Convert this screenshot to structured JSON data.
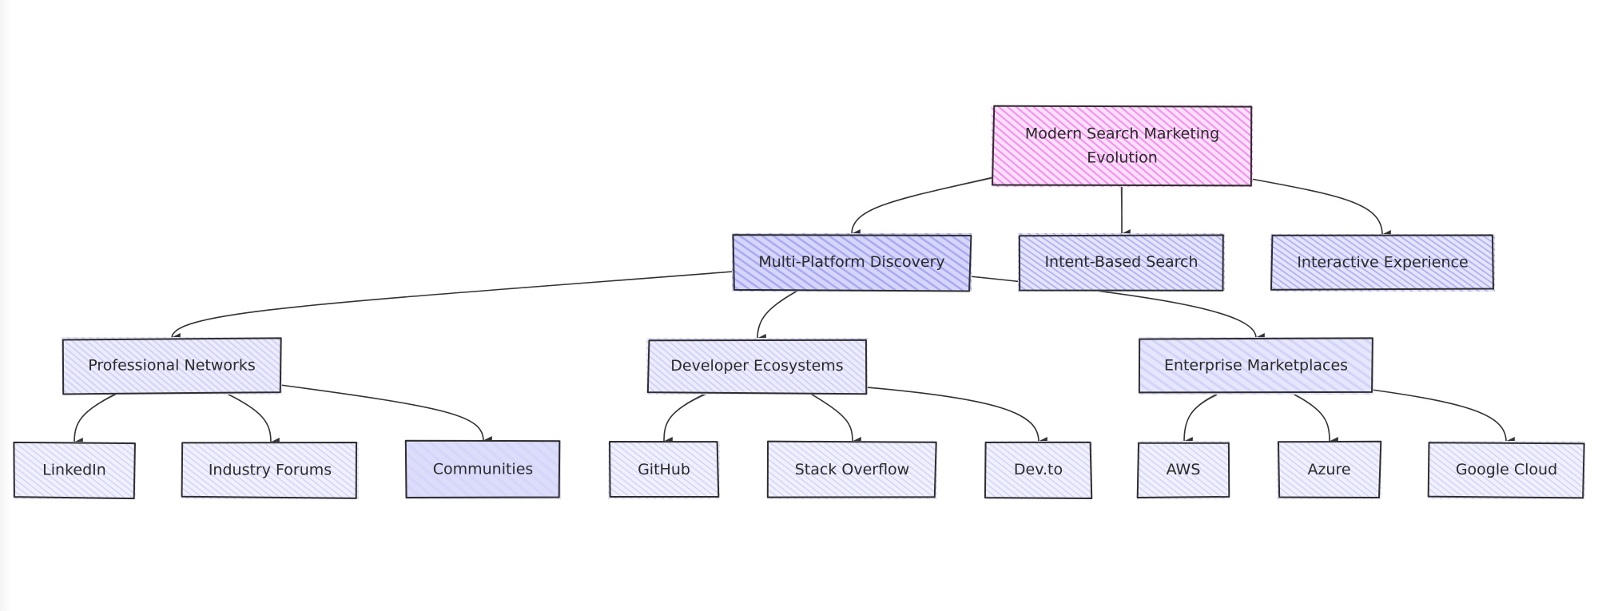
{
  "diagram": {
    "type": "flowchart-tree",
    "style": "hand-drawn",
    "colors": {
      "root_fill": "#f7a6f2",
      "level1_fill": "#b8b8f5",
      "level2_fill": "#d8d8fa",
      "leaf_fill": "#dcdcfb",
      "stroke": "#2e2e2e",
      "text": "#2b2b2b"
    },
    "nodes": [
      {
        "id": "root",
        "label_lines": [
          "Modern Search Marketing",
          "Evolution"
        ],
        "level": 0
      },
      {
        "id": "mpd",
        "label_lines": [
          "Multi-Platform Discovery"
        ],
        "level": 1
      },
      {
        "id": "ibs",
        "label_lines": [
          "Intent-Based Search"
        ],
        "level": 1
      },
      {
        "id": "ie",
        "label_lines": [
          "Interactive Experience"
        ],
        "level": 1
      },
      {
        "id": "pn",
        "label_lines": [
          "Professional Networks"
        ],
        "level": 2
      },
      {
        "id": "de",
        "label_lines": [
          "Developer Ecosystems"
        ],
        "level": 2
      },
      {
        "id": "em",
        "label_lines": [
          "Enterprise Marketplaces"
        ],
        "level": 2
      },
      {
        "id": "linkedin",
        "label_lines": [
          "LinkedIn"
        ],
        "level": 3
      },
      {
        "id": "forums",
        "label_lines": [
          "Industry Forums"
        ],
        "level": 3
      },
      {
        "id": "communities",
        "label_lines": [
          "Communities"
        ],
        "level": 3
      },
      {
        "id": "github",
        "label_lines": [
          "GitHub"
        ],
        "level": 3
      },
      {
        "id": "so",
        "label_lines": [
          "Stack Overflow"
        ],
        "level": 3
      },
      {
        "id": "devto",
        "label_lines": [
          "Dev.to"
        ],
        "level": 3
      },
      {
        "id": "aws",
        "label_lines": [
          "AWS"
        ],
        "level": 3
      },
      {
        "id": "azure",
        "label_lines": [
          "Azure"
        ],
        "level": 3
      },
      {
        "id": "gcloud",
        "label_lines": [
          "Google Cloud"
        ],
        "level": 3
      }
    ],
    "edges": [
      {
        "from": "root",
        "to": "mpd"
      },
      {
        "from": "root",
        "to": "ibs"
      },
      {
        "from": "root",
        "to": "ie"
      },
      {
        "from": "mpd",
        "to": "pn"
      },
      {
        "from": "mpd",
        "to": "de"
      },
      {
        "from": "mpd",
        "to": "em"
      },
      {
        "from": "pn",
        "to": "linkedin"
      },
      {
        "from": "pn",
        "to": "forums"
      },
      {
        "from": "pn",
        "to": "communities"
      },
      {
        "from": "de",
        "to": "github"
      },
      {
        "from": "de",
        "to": "so"
      },
      {
        "from": "de",
        "to": "devto"
      },
      {
        "from": "em",
        "to": "aws"
      },
      {
        "from": "em",
        "to": "azure"
      },
      {
        "from": "em",
        "to": "gcloud"
      }
    ]
  }
}
